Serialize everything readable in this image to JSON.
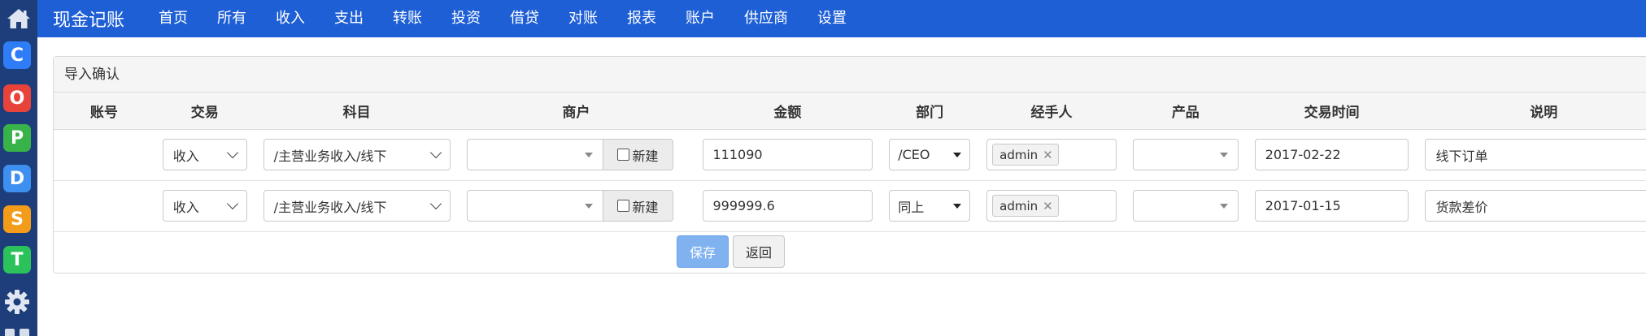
{
  "rail": {
    "apps": [
      {
        "letter": "C",
        "color": "#2f7df6"
      },
      {
        "letter": "O",
        "color": "#e8433a"
      },
      {
        "letter": "P",
        "color": "#38b349"
      },
      {
        "letter": "D",
        "color": "#3d8ff0"
      },
      {
        "letter": "S",
        "color": "#f39c19"
      },
      {
        "letter": "T",
        "color": "#2bc25b"
      }
    ]
  },
  "nav": {
    "brand": "现金记账",
    "items": [
      "首页",
      "所有",
      "收入",
      "支出",
      "转账",
      "投资",
      "借贷",
      "对账",
      "报表",
      "账户",
      "供应商",
      "设置"
    ]
  },
  "panel": {
    "title": "导入确认",
    "columns": [
      "账号",
      "交易",
      "科目",
      "商户",
      "金额",
      "部门",
      "经手人",
      "产品",
      "交易时间",
      "说明"
    ],
    "rows": [
      {
        "account": "",
        "type": "收入",
        "subject": "/主营业务收入/线下",
        "merchant": "",
        "new_label": "新建",
        "amount": "111090",
        "dept": "/CEO",
        "handler": "admin",
        "product": "",
        "date": "2017-02-22",
        "note": "线下订单"
      },
      {
        "account": "",
        "type": "收入",
        "subject": "/主营业务收入/线下",
        "merchant": "",
        "new_label": "新建",
        "amount": "999999.6",
        "dept": "同上",
        "handler": "admin",
        "product": "",
        "date": "2017-01-15",
        "note": "货款差价"
      }
    ],
    "save_label": "保存",
    "back_label": "返回"
  }
}
